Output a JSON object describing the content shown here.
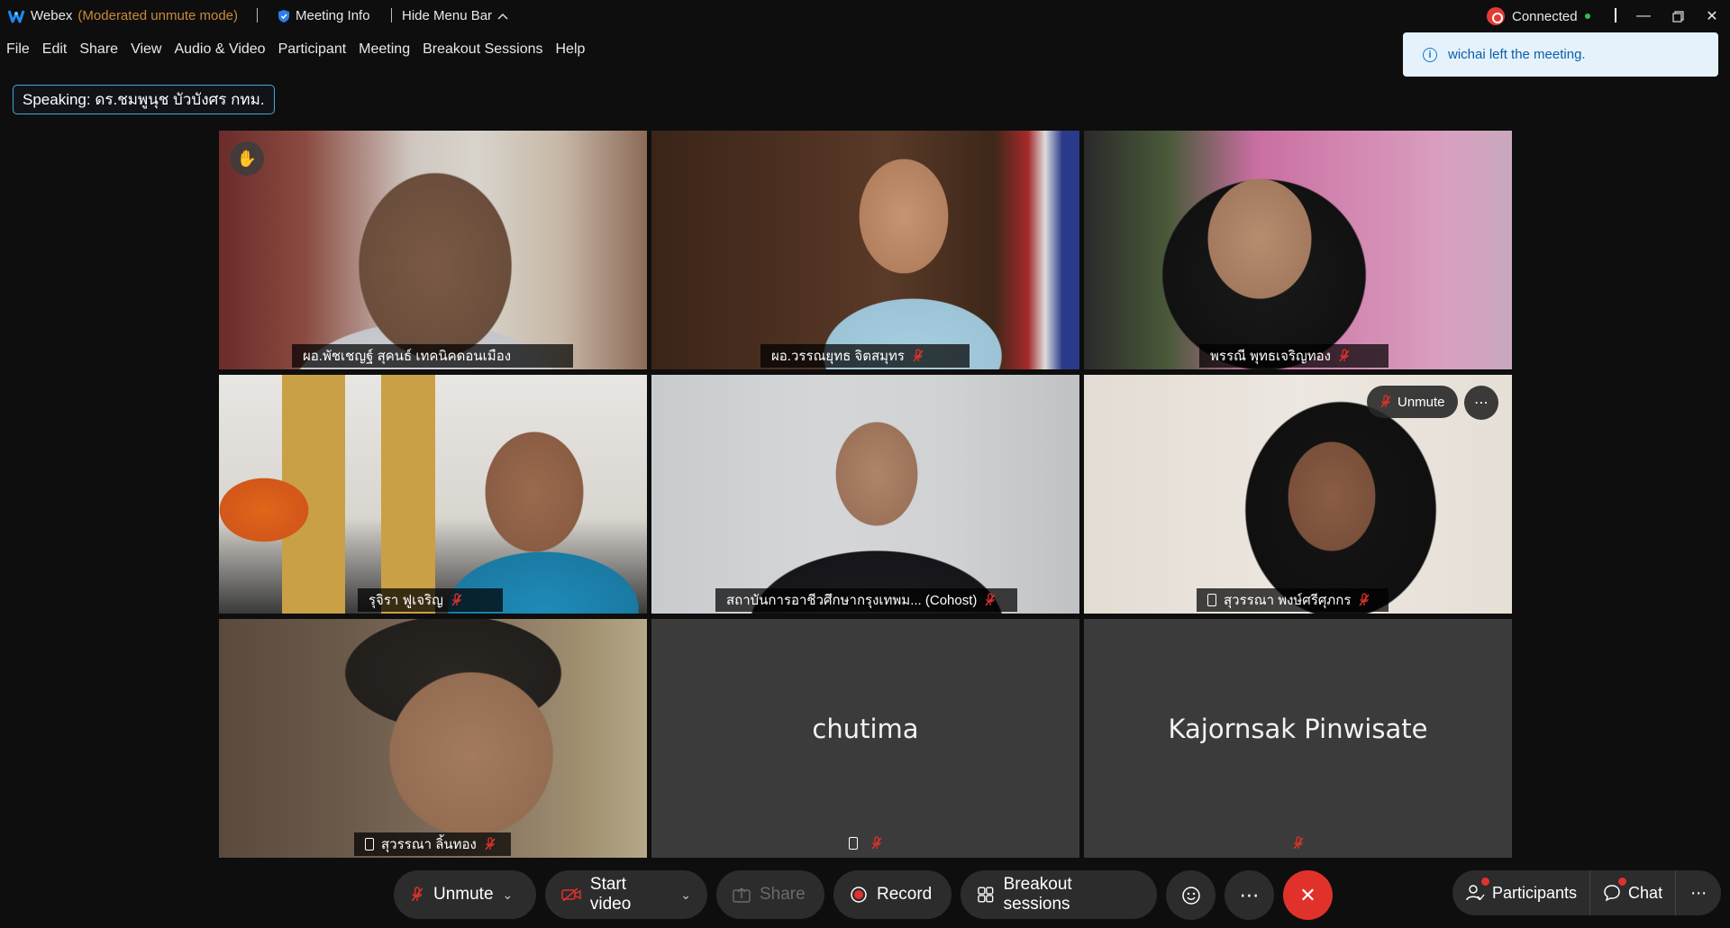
{
  "titlebar": {
    "app_name": "Webex",
    "mode": "(Moderated unmute mode)",
    "meeting_info": "Meeting Info",
    "hide_menu_bar": "Hide Menu Bar",
    "connection": "Connected"
  },
  "menu": {
    "items": [
      {
        "label": "File"
      },
      {
        "label": "Edit"
      },
      {
        "label": "Share"
      },
      {
        "label": "View"
      },
      {
        "label": "Audio & Video"
      },
      {
        "label": "Participant"
      },
      {
        "label": "Meeting"
      },
      {
        "label": "Breakout Sessions"
      },
      {
        "label": "Help"
      }
    ]
  },
  "notification": {
    "text": "wichai left the meeting."
  },
  "speaking": {
    "text": "Speaking: ดร.ชมพูนุช บัวบังศร กทม."
  },
  "tiles": [
    {
      "name": "ผอ.พัชเชญฐ์ สุคนธ์ เทคนิคดอนเมือง",
      "muted": false,
      "hand_raised": true
    },
    {
      "name": "ผอ.วรรณยุทธ จิตสมุทร",
      "muted": true
    },
    {
      "name": "พรรณี พุทธเจริญทอง",
      "muted": true
    },
    {
      "name": "รุจิรา ฟูเจริญ",
      "muted": true
    },
    {
      "name": "สถาบันการอาชีวศึกษากรุงเทพม... (Cohost)",
      "muted": true
    },
    {
      "name": "สุวรรณา พงษ์ศรีศุภกร",
      "muted": true,
      "phone": true,
      "unmute_label": "Unmute"
    },
    {
      "name": "สุวรรณา ลิ้นทอง",
      "muted": true,
      "phone": true
    },
    {
      "name": "chutima",
      "muted": true,
      "phone": true,
      "video": false
    },
    {
      "name": "Kajornsak Pinwisate",
      "muted": true,
      "video": false
    }
  ],
  "toolbar": {
    "unmute": "Unmute",
    "start_video": "Start video",
    "share": "Share",
    "record": "Record",
    "breakout": "Breakout sessions",
    "participants": "Participants",
    "chat": "Chat"
  },
  "colors": {
    "end_button": "#e0322b",
    "mode_text": "#c98a3a",
    "toast_bg": "#e6f2fb",
    "speaking_border": "#4aa3df"
  }
}
